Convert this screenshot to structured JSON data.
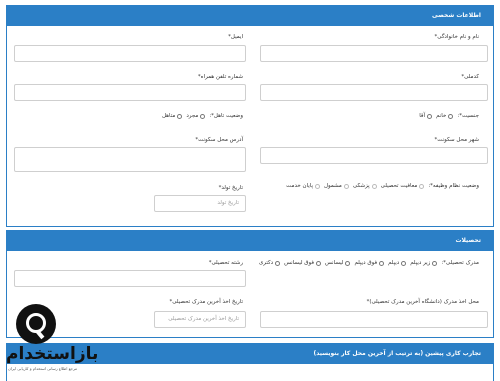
{
  "personal": {
    "title": "اطلاعات شخصی",
    "name_label": "نام و نام خانوادگی*",
    "email_label": "ایمیل*",
    "national_code_label": "کدملی*",
    "phone_label": "شماره تلفن همراه*",
    "gender_label": "جنسیت*:",
    "gender_options": [
      "خانم",
      "آقا"
    ],
    "marital_label": "وضعیت تاهل*:",
    "marital_options": [
      "مجرد",
      "متاهل"
    ],
    "city_label": "شهر محل سکونت*",
    "address_label": "آدرس محل سکونت*",
    "military_label": "وضعیت نظام وظیفه*:",
    "military_options": [
      "معافیت تحصیلی",
      "پزشکی",
      "مشمول",
      "پایان خدمت"
    ],
    "birth_label": "تاریخ تولد*",
    "birth_placeholder": "تاریخ تولد"
  },
  "education": {
    "title": "تحصیلات",
    "degree_label": "مدرک تحصیلی*:",
    "degree_options": [
      "زیر دیپلم",
      "دیپلم",
      "فوق دیپلم",
      "لیسانس",
      "فوق لیسانس",
      "دکتری"
    ],
    "field_label": "رشته تحصیلی*",
    "place_label": "محل اخذ مدرک (دانشگاه آخرین مدرک تحصیلی)*",
    "date_label": "تاریخ اخذ آخرین مدرک تحصیلی*",
    "date_placeholder": "تاریخ اخذ آخرین مدرک تحصیلی"
  },
  "experience": {
    "title": "تجارب کاری پیشین (به ترتیب از آخرین محل کار بنویسید)"
  },
  "logo": {
    "text": "بازاستخدام",
    "tagline": "مرجع اطلاع رسانی استخدام و کاریابی ایران"
  }
}
